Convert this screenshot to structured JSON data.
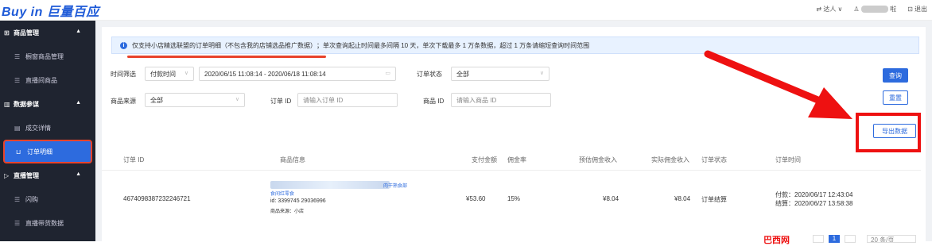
{
  "header": {
    "logo": "Buy in 巨量百应",
    "right": {
      "expert": "⇄ 达人 ∨",
      "user_suffix": "啦",
      "logout": "⊡ 退出"
    }
  },
  "sidebar": {
    "groups": [
      {
        "label": "商品管理",
        "icon": "grid-icon",
        "items": [
          "橱窗商品管理",
          "直播间商品"
        ]
      },
      {
        "label": "数据参谋",
        "icon": "chart-icon",
        "items": [
          "成交详情",
          "订单明细"
        ]
      },
      {
        "label": "直播管理",
        "icon": "live-icon",
        "items": [
          "闪购",
          "直播带货数据"
        ]
      }
    ],
    "active_item": "订单明细"
  },
  "notice": {
    "highlight": "仅支持小店精选联盟的订单明细（不包含我的店铺选品推广数据）",
    "rest": "；单次查询起止时间最多间隔 10 天，单次下载最多 1 万条数据，超过 1 万条请缩短查询时间范围"
  },
  "filters": {
    "time_label": "时间筛选",
    "time_type": "付款时间",
    "date_range": "2020/06/15 11:08:14  -  2020/06/18 11:08:14",
    "status_label": "订单状态",
    "status_value": "全部",
    "source_label": "商品来源",
    "source_value": "全部",
    "order_id_label": "订单 ID",
    "order_id_placeholder": "请输入订单 ID",
    "product_id_label": "商品 ID",
    "product_id_placeholder": "请输入商品 ID"
  },
  "buttons": {
    "query": "查询",
    "reset": "重置",
    "export": "导出数据"
  },
  "table": {
    "headers": [
      "订单 ID",
      "商品信息",
      "支付金额",
      "佣金率",
      "预估佣金收入",
      "实际佣金收入",
      "订单状态",
      "订单时间"
    ],
    "row": {
      "order_id": "4674098387232246721",
      "product_tag": "肉干熟食部",
      "product_name": "食间红零食",
      "product_id": "id: 3399745      29036996",
      "product_source": "商品来源：小店",
      "pay_amount": "¥53.60",
      "commission_rate": "15%",
      "est_commission": "¥8.04",
      "actual_commission": "¥8.04",
      "status": "订单结算",
      "pay_time": "付款：2020/06/17 12:43:04",
      "settle_time": "结算：2020/06/27 13:58:38"
    }
  },
  "pagination": {
    "watermark": "巴西网",
    "current_page": "1",
    "page_size": "20 条/页"
  }
}
